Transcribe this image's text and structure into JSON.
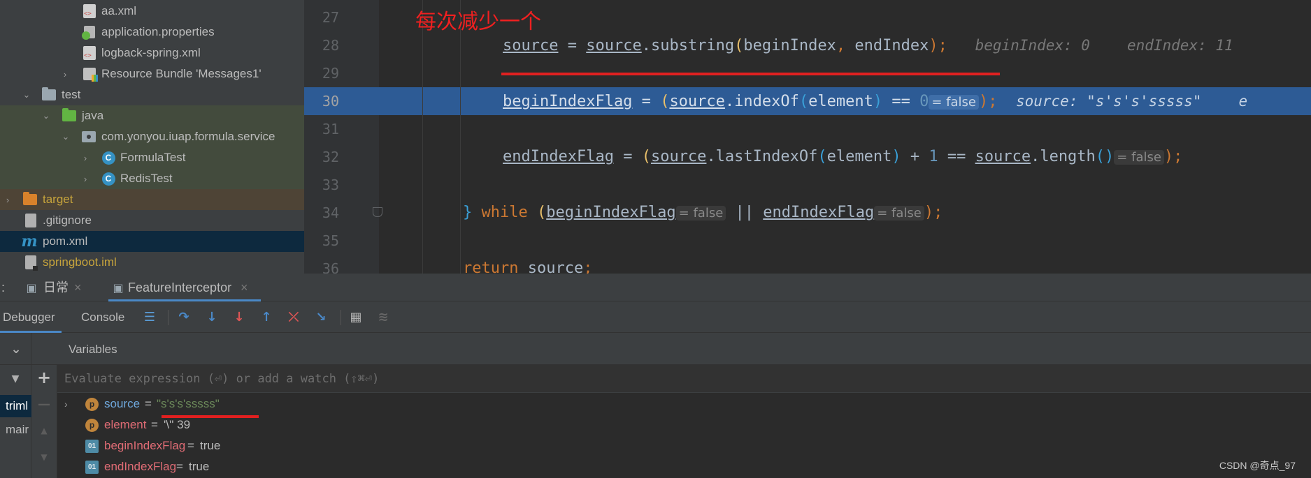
{
  "project_tree": {
    "items": [
      {
        "label": "aa.xml",
        "icon": "xml-file-icon"
      },
      {
        "label": "application.properties",
        "icon": "properties-file-icon"
      },
      {
        "label": "logback-spring.xml",
        "icon": "xml-file-icon"
      },
      {
        "label": "Resource Bundle 'Messages1'",
        "icon": "resource-bundle-icon"
      },
      {
        "label": "test",
        "icon": "folder-icon"
      },
      {
        "label": "java",
        "icon": "test-source-folder-icon"
      },
      {
        "label": "com.yonyou.iuap.formula.service",
        "icon": "package-icon"
      },
      {
        "label": "FormulaTest",
        "icon": "class-icon"
      },
      {
        "label": "RedisTest",
        "icon": "class-icon"
      },
      {
        "label": "target",
        "icon": "excluded-folder-icon"
      },
      {
        "label": ".gitignore",
        "icon": "git-file-icon"
      },
      {
        "label": "pom.xml",
        "icon": "maven-icon"
      },
      {
        "label": "springboot.iml",
        "icon": "iml-file-icon"
      }
    ],
    "class_badge": "C"
  },
  "editor": {
    "annotation": "每次减少一个",
    "line_numbers": [
      "27",
      "28",
      "29",
      "30",
      "31",
      "32",
      "33",
      "34",
      "35",
      "36"
    ],
    "current_line": "30",
    "code": {
      "l28": {
        "v1": "source",
        "eq": " = ",
        "v2": "source",
        "call": ".substring",
        "a1": "beginIndex",
        "comma": ", ",
        "a2": "endIndex",
        "end": ");",
        "inline1": "beginIndex: 0",
        "inline2": "endIndex: 11"
      },
      "l30": {
        "v1": "beginIndexFlag",
        "eq": " = ",
        "v2": "source",
        "call": ".indexOf",
        "a1": "element",
        "op": " == ",
        "num": "0",
        "hint": "= false",
        "end": ");",
        "inline1": "source: \"s's's'sssss\"",
        "inline2": "e"
      },
      "l32": {
        "v1": "endIndexFlag",
        "eq": " = ",
        "v2": "source",
        "call": ".lastIndexOf",
        "a1": "element",
        "op1": " + ",
        "num": "1",
        "op2": " == ",
        "v3": "source",
        "call2": ".length",
        "hint": "= false",
        "end": ");"
      },
      "l34": {
        "brace": "}",
        "kw": " while ",
        "v1": "beginIndexFlag",
        "hint1": "= false",
        "or": " || ",
        "v2": "endIndexFlag",
        "hint2": "= false",
        "end": ");"
      },
      "l36": {
        "kw": "return",
        "v1": " source",
        "end": ";"
      }
    }
  },
  "tool_window": {
    "tabs": [
      {
        "label": "日常",
        "close": "×"
      },
      {
        "label": "FeatureInterceptor",
        "close": "×"
      }
    ],
    "left_label": ":",
    "toolbar_tabs": [
      "Debugger",
      "Console"
    ],
    "variables_title": "Variables",
    "eval_placeholder": "Evaluate expression (⏎) or add a watch (⇧⌘⏎)",
    "add_label": "+",
    "frames": [
      "triml",
      "mair"
    ],
    "variables": [
      {
        "badge": "p",
        "name": "source",
        "eq": " = ",
        "value": "\"s's's'sssss\""
      },
      {
        "badge": "p",
        "name": "element",
        "eq": " = ",
        "value": "'\\'' 39"
      },
      {
        "badge": "01",
        "name": "beginIndexFlag",
        "eq": " = ",
        "value": "true"
      },
      {
        "badge": "01",
        "name": "endIndexFlag",
        "eq": " = ",
        "value": "true"
      }
    ]
  },
  "watermark": "CSDN @奇点_97",
  "colors": {
    "annotation_red": "#e02020",
    "current_line": "#2d5b95",
    "keyword": "#cc7832",
    "number": "#6897bb"
  }
}
